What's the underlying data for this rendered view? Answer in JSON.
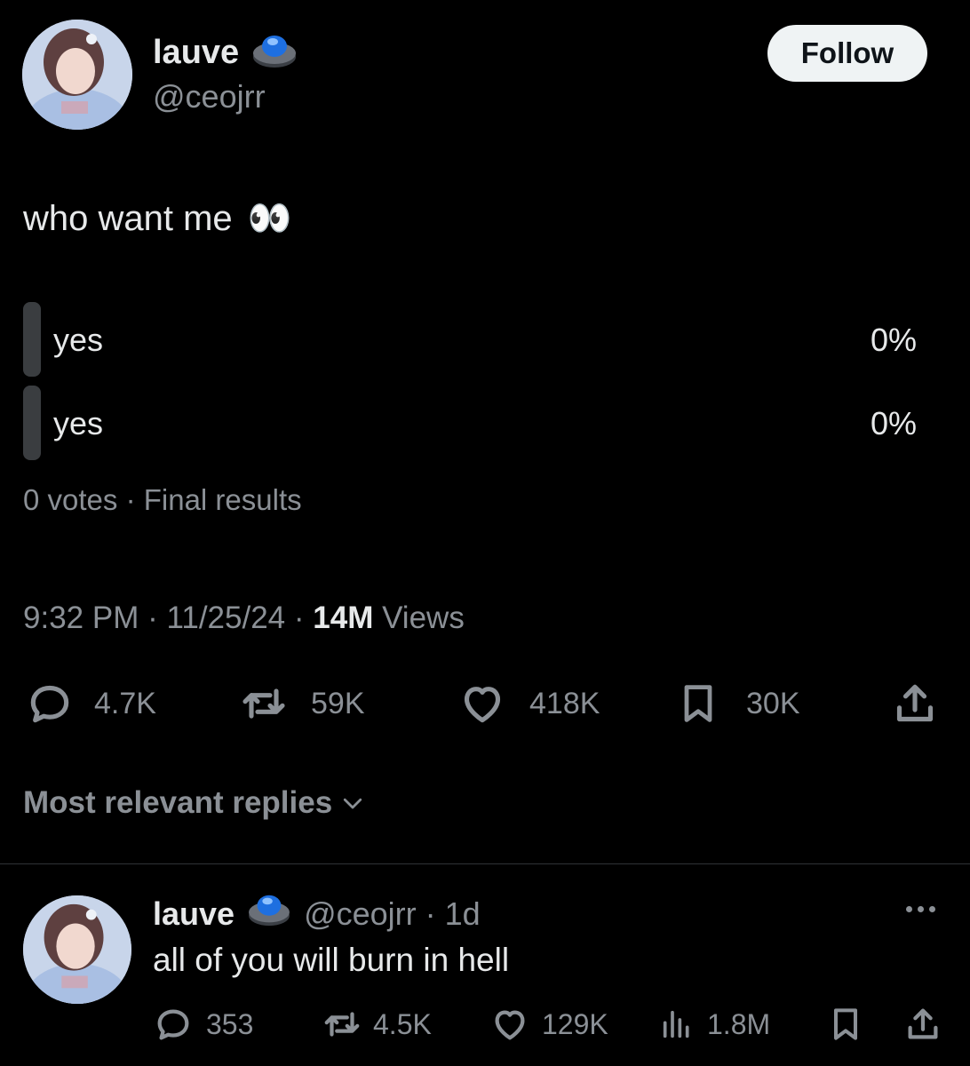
{
  "tweet": {
    "author": {
      "name": "lauve",
      "handle": "@ceojrr",
      "avatar_icon": "profile-photo",
      "badge_icon": "blue-button-emoji"
    },
    "follow_label": "Follow",
    "text": "who want me",
    "text_emoji": "👀",
    "poll": {
      "options": [
        {
          "label": "yes",
          "percent": "0%",
          "fill": 0
        },
        {
          "label": "yes",
          "percent": "0%",
          "fill": 0
        }
      ],
      "summary": "0 votes · Final results"
    },
    "time": "9:32 PM",
    "date": "11/25/24",
    "views_count": "14M",
    "views_label": "Views",
    "actions": {
      "replies": "4.7K",
      "reposts": "59K",
      "likes": "418K",
      "bookmarks": "30K"
    }
  },
  "replies_sort_label": "Most relevant replies",
  "reply": {
    "author": {
      "name": "lauve",
      "handle": "@ceojrr",
      "time": "1d",
      "avatar_icon": "profile-photo",
      "badge_icon": "blue-button-emoji"
    },
    "text": "all of you will burn in hell",
    "actions": {
      "replies": "353",
      "reposts": "4.5K",
      "likes": "129K",
      "views": "1.8M"
    }
  },
  "colors": {
    "background": "#000000",
    "text": "#e7e9ea",
    "secondary_text": "#8b9096",
    "poll_bar": "#3a3d40",
    "follow_button": "#eff3f4"
  }
}
